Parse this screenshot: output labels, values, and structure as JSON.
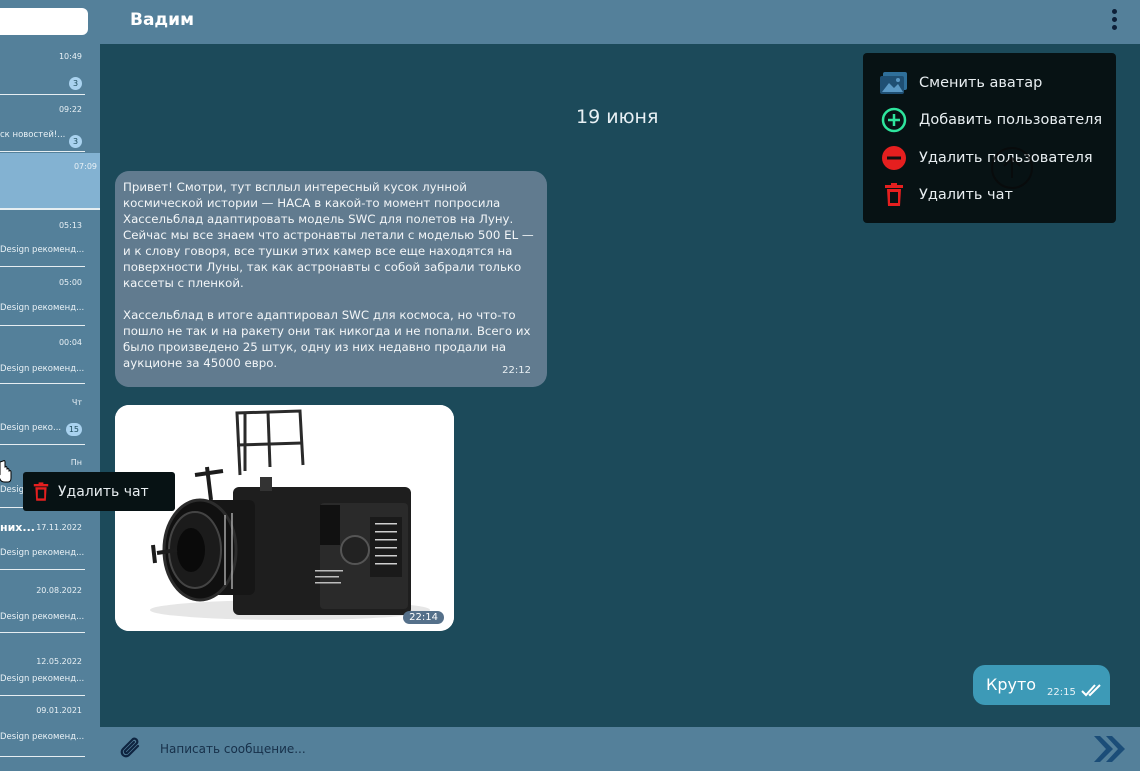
{
  "header": {
    "contact_name": "Вадим"
  },
  "chat_list": [
    {
      "time": "10:49",
      "preview": "",
      "badge": "3"
    },
    {
      "time": "09:22",
      "preview": "ск новостей!...",
      "badge": "3"
    },
    {
      "time": "07:09",
      "preview": "",
      "badge": ""
    },
    {
      "time": "05:13",
      "preview": "Design рекоменд...",
      "badge": ""
    },
    {
      "time": "05:00",
      "preview": "Design рекоменд...",
      "badge": ""
    },
    {
      "time": "00:04",
      "preview": "Design рекоменд...",
      "badge": ""
    },
    {
      "time": "Чт",
      "preview": "Design реко...",
      "badge": "15"
    },
    {
      "time": "Пн",
      "preview": "Design",
      "badge": ""
    },
    {
      "name": "них...",
      "time": "17.11.2022",
      "preview": "Design рекоменд...",
      "badge": ""
    },
    {
      "time": "20.08.2022",
      "preview": "Design рекоменд...",
      "badge": ""
    },
    {
      "time": "12.05.2022",
      "preview": "Design рекоменд...",
      "badge": ""
    },
    {
      "time": "09.01.2021",
      "preview": "Design рекоменд...",
      "badge": ""
    }
  ],
  "conversation": {
    "date": "19 июня",
    "incoming_text": {
      "paragraph1": "Привет! Смотри, тут всплыл интересный кусок лунной космической истории — НАСА в какой-то момент попросила Хассельблад адаптировать модель SWC для полетов на Луну. Сейчас мы все знаем что астронавты летали с моделью 500 EL — и к слову говоря, все тушки этих камер все еще находятся на поверхности Луны, так как астронавты с собой забрали только кассеты с пленкой.",
      "paragraph2": "Хассельблад в итоге адаптировал SWC для космоса, но что-то пошло не так и на ракету они так никогда и не попали. Всего их было произведено 25 штук, одну из них недавно продали на аукционе за 45000 евро.",
      "time": "22:12"
    },
    "incoming_photo": {
      "time": "22:14"
    },
    "outgoing_text": {
      "text": "Круто",
      "time": "22:15"
    }
  },
  "dropdown_menu": {
    "items": [
      {
        "label": "Сменить аватар",
        "icon": "image-icon",
        "color": "#2f6f9a"
      },
      {
        "label": "Добавить пользователя",
        "icon": "plus-circle-icon",
        "color": "#2ee59d"
      },
      {
        "label": "Удалить пользователя",
        "icon": "minus-circle-icon",
        "color": "#e51f1f"
      },
      {
        "label": "Удалить чат",
        "icon": "trash-icon",
        "color": "#e51f1f"
      }
    ]
  },
  "context_menu": {
    "label": "Удалить чат",
    "icon": "trash-icon"
  },
  "composer": {
    "placeholder": "Написать сообщение..."
  }
}
